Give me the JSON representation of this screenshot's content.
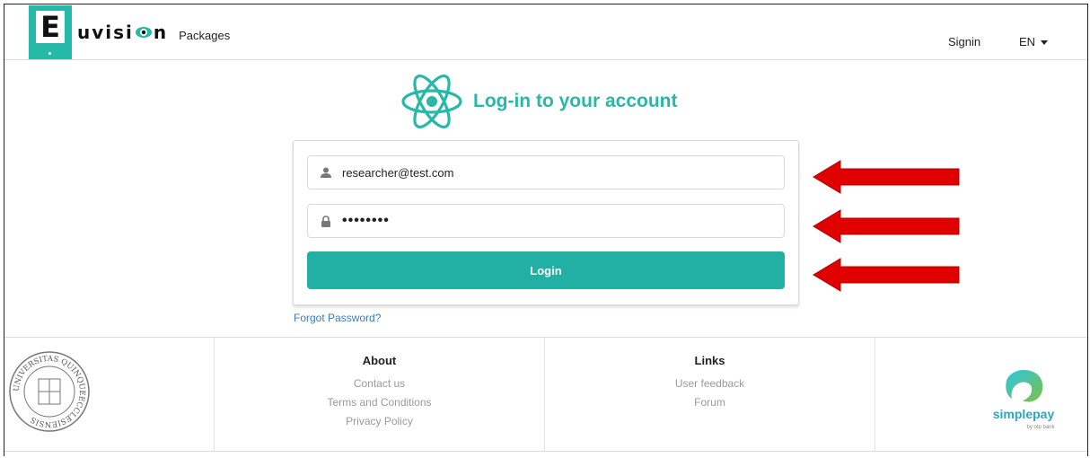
{
  "header": {
    "logo_letter": "E",
    "logo_text_prefix": "uvisi",
    "logo_text_suffix": "n",
    "packages": "Packages",
    "signin": "Signin",
    "language": "EN"
  },
  "login": {
    "title": "Log-in to your account",
    "email_value": "researcher@test.com",
    "password_mask": "••••••••",
    "button_label": "Login",
    "forgot_password": "Forgot Password?"
  },
  "footer": {
    "about": {
      "heading": "About",
      "links": [
        "Contact us",
        "Terms and Conditions",
        "Privacy Policy"
      ]
    },
    "links": {
      "heading": "Links",
      "links": [
        "User feedback",
        "Forum"
      ]
    },
    "seal_text": "UNIVERSITAS QUINQUEECCLESIENSIS",
    "payment_logo": "simplepay",
    "payment_sub": "by otp bank"
  },
  "colors": {
    "accent": "#26b9a7",
    "button": "#23b0a4",
    "arrow": "#e00000",
    "link": "#3a7bbf"
  },
  "icons": [
    "react-icon",
    "user-icon",
    "lock-icon",
    "red-arrow-icon",
    "chevron-down-icon"
  ]
}
